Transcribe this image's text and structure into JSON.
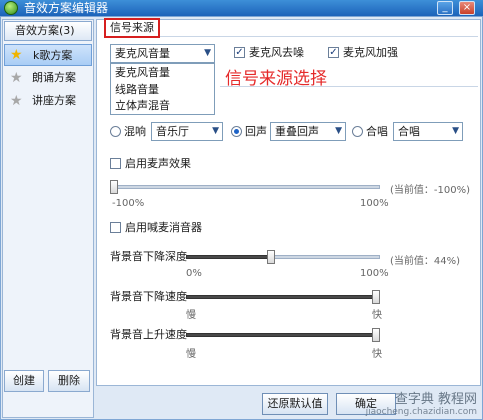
{
  "window": {
    "title": "音效方案编辑器",
    "minimize_label": "_",
    "close_label": "×"
  },
  "sidebar": {
    "header": "音效方案(3)",
    "items": [
      {
        "label": "k歌方案",
        "active": true
      },
      {
        "label": "朗诵方案",
        "active": false
      },
      {
        "label": "讲座方案",
        "active": false
      }
    ],
    "create_label": "创建",
    "delete_label": "删除"
  },
  "signal": {
    "tab_label": "信号来源",
    "source_value": "麦克风音量",
    "options": [
      "麦克风音量",
      "线路音量",
      "立体声混音"
    ],
    "denoise_label": "麦克风去噪",
    "denoise_checked": true,
    "boost_label": "麦克风加强",
    "boost_checked": true,
    "annotation": "信号来源选择"
  },
  "effects": {
    "reverb_label": "混响",
    "reverb_value": "音乐厅",
    "echo_label": "回声",
    "echo_value": "重叠回声",
    "chorus_label": "合唱",
    "chorus_value": "合唱",
    "selected": "echo"
  },
  "mic_effect": {
    "enable_label": "启用麦声效果",
    "min_label": "-100%",
    "max_label": "100%",
    "current_text": "(当前值：-100%)",
    "value_percent": -100
  },
  "dehowl": {
    "label": "启用喊麦消音器"
  },
  "bg_volume": {
    "label": "背景音下降深度",
    "min_label": "0%",
    "max_label": "100%",
    "current_text": "(当前值：44%)",
    "value_percent": 44
  },
  "bg_down_speed": {
    "label": "背景音下降速度",
    "slow": "慢",
    "fast": "快",
    "value_fraction": 1.0
  },
  "bg_up_speed": {
    "label": "背景音上升速度",
    "slow": "慢",
    "fast": "快",
    "value_fraction": 1.0
  },
  "footer": {
    "restore_label": "还原默认值",
    "confirm_label": "确定"
  },
  "watermark": {
    "line1": "查字典 教程网",
    "line2": "jiaocheng.chazidian.com"
  }
}
